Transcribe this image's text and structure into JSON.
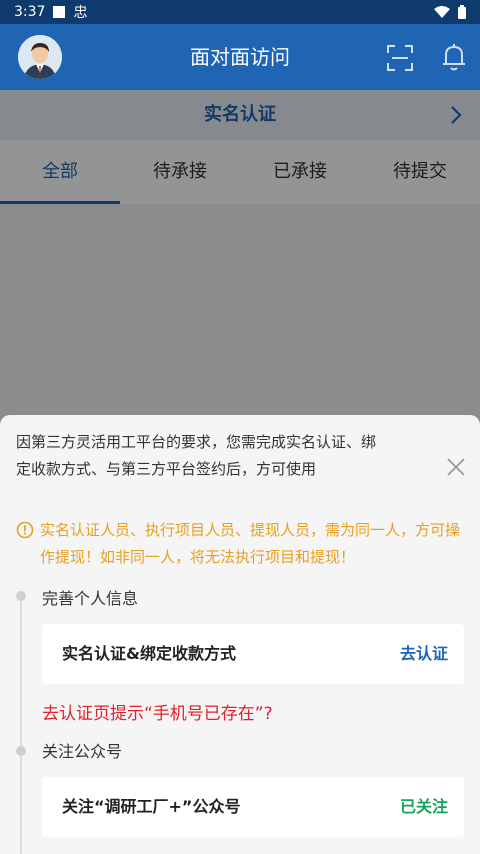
{
  "status_bar": {
    "time": "3:37",
    "app_glyph": "忠"
  },
  "header": {
    "title": "面对面访问"
  },
  "banner": {
    "label": "实名认证"
  },
  "tabs": [
    {
      "label": "全部",
      "active": true
    },
    {
      "label": "待承接",
      "active": false
    },
    {
      "label": "已承接",
      "active": false
    },
    {
      "label": "待提交",
      "active": false
    }
  ],
  "sheet": {
    "intro": "因第三方灵活用工平台的要求，您需完成实名认证、绑定收款方式、与第三方平台签约后，方可使用",
    "warning": "实名认证人员、执行项目人员、提现人员，需为同一人，方可操作提现！如非同一人，将无法执行项目和提现！",
    "steps": [
      {
        "label": "完善个人信息",
        "card_title": "实名认证&绑定收款方式",
        "action": "去认证"
      },
      {
        "label": "关注公众号",
        "card_title": "关注“调研工厂+”公众号",
        "action": "已关注"
      }
    ],
    "red_hint": "去认证页提示“手机号已存在”?"
  },
  "colors": {
    "primary": "#1f65b3",
    "warning": "#e8a020",
    "success": "#1aa35a",
    "error": "#e0202a"
  }
}
